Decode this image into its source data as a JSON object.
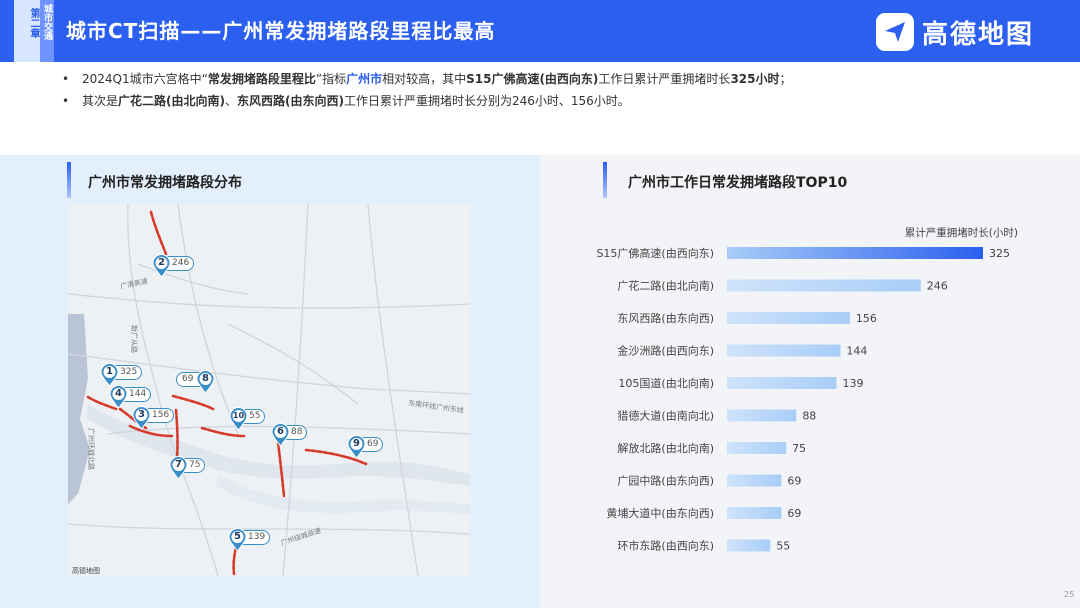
{
  "header": {
    "chapter_tab": "第二章",
    "sub_tab": "城市交通",
    "title": "城市CT扫描——广州常发拥堵路段里程比最高",
    "logo_text": "高德地图",
    "color": "#2b5ff0"
  },
  "bullets": {
    "b1_a": "2024Q1城市六宫格中“",
    "b1_b": "常发拥堵路段里程比",
    "b1_c": "”指标",
    "b1_d": "广州市",
    "b1_e": "相对较高，其中",
    "b1_f": "S15广佛高速(由西向东)",
    "b1_g": "工作日累计严重拥堵时长",
    "b1_h": "325小时",
    "b1_i": "；",
    "b2_a": "其次是",
    "b2_b": "广花二路(由北向南)",
    "b2_c": "、",
    "b2_d": "东风西路(由东向西)",
    "b2_e": "工作日累计严重拥堵时长分别为246小时、156小时。"
  },
  "left_panel": {
    "title": "广州市常发拥堵路段分布",
    "map_labels": [
      "广清高速",
      "新广从路",
      "东南环线广州东线",
      "广州绕城高速",
      "广州环城北路"
    ],
    "map_logo": "高德地图",
    "markers": [
      {
        "num": "1",
        "value": "325"
      },
      {
        "num": "2",
        "value": "246"
      },
      {
        "num": "3",
        "value": "156"
      },
      {
        "num": "4",
        "value": "144"
      },
      {
        "num": "5",
        "value": "139"
      },
      {
        "num": "6",
        "value": "88"
      },
      {
        "num": "7",
        "value": "75"
      },
      {
        "num": "8",
        "value": "69"
      },
      {
        "num": "9",
        "value": "69"
      },
      {
        "num": "10",
        "value": "55"
      }
    ]
  },
  "right_panel": {
    "title": "广州市工作日常发拥堵路段TOP10"
  },
  "chart_data": {
    "type": "bar",
    "orientation": "horizontal",
    "title": "广州市工作日常发拥堵路段TOP10",
    "value_label": "累计严重拥堵时长(小时)",
    "categories": [
      "S15广佛高速(由西向东)",
      "广花二路(由北向南)",
      "东风西路(由东向西)",
      "金沙洲路(由西向东)",
      "105国道(由北向南)",
      "猎德大道(由南向北)",
      "解放北路(由北向南)",
      "广园中路(由东向西)",
      "黄埔大道中(由东向西)",
      "环市东路(由西向东)"
    ],
    "values": [
      325,
      246,
      156,
      144,
      139,
      88,
      75,
      69,
      69,
      55
    ],
    "xlim": [
      0,
      325
    ],
    "grid": false,
    "colors": {
      "bar_light": "#cfe3fb",
      "bar_mid": "#a8cdf7",
      "bar_top": "#2b5ff0"
    }
  },
  "page_number": "25"
}
